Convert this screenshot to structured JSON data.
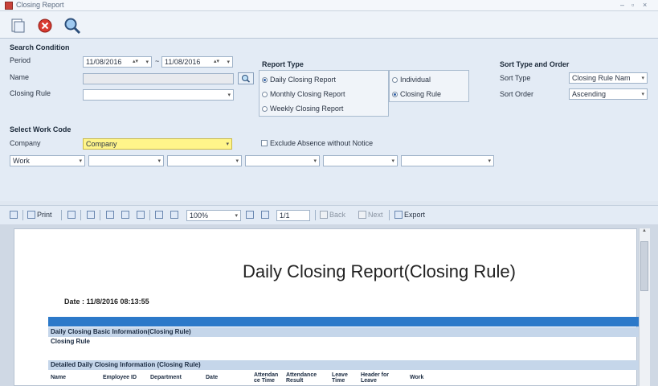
{
  "window": {
    "title": "Closing Report",
    "controls": [
      "–",
      "▫",
      "×"
    ]
  },
  "toolbar": {
    "buttons": [
      "new-icon",
      "close-icon",
      "search-icon"
    ]
  },
  "search": {
    "heading": "Search Condition",
    "period_label": "Period",
    "date_from": "11/08/2016",
    "date_sep": "~",
    "date_to": "11/08/2016",
    "name_label": "Name",
    "name_value": "",
    "closing_rule_label": "Closing Rule",
    "closing_rule_value": ""
  },
  "report_type": {
    "heading": "Report Type",
    "options": [
      "Daily Closing Report",
      "Monthly Closing Report",
      "Weekly Closing Report"
    ],
    "selected": 0,
    "scope_options": [
      "Individual",
      "Closing Rule"
    ],
    "scope_selected": 1
  },
  "sort": {
    "heading": "Sort Type and Order",
    "type_label": "Sort Type",
    "type_value": "Closing Rule Nam",
    "order_label": "Sort Order",
    "order_value": "Ascending"
  },
  "work_code": {
    "heading": "Select Work Code",
    "company_label": "Company",
    "company_value": "Company",
    "exclude_label": "Exclude Absence without Notice",
    "work_value": "Work"
  },
  "report_toolbar": {
    "print": "Print",
    "zoom": "100%",
    "page": "1/1",
    "back": "Back",
    "next": "Next",
    "export": "Export"
  },
  "report": {
    "title": "Daily Closing Report(Closing Rule)",
    "date_label": "Date : 11/8/2016 08:13:55",
    "section1": "Daily Closing Basic Information(Closing Rule)",
    "section1_row": "Closing Rule",
    "section2": "Detailed Daily Closing Information (Closing Rule)",
    "columns": [
      "Name",
      "Employee ID",
      "Department",
      "Date",
      "Attendan ce Time",
      "Attendance Result",
      "Leave Time",
      "Header for Leave",
      "Work"
    ]
  }
}
